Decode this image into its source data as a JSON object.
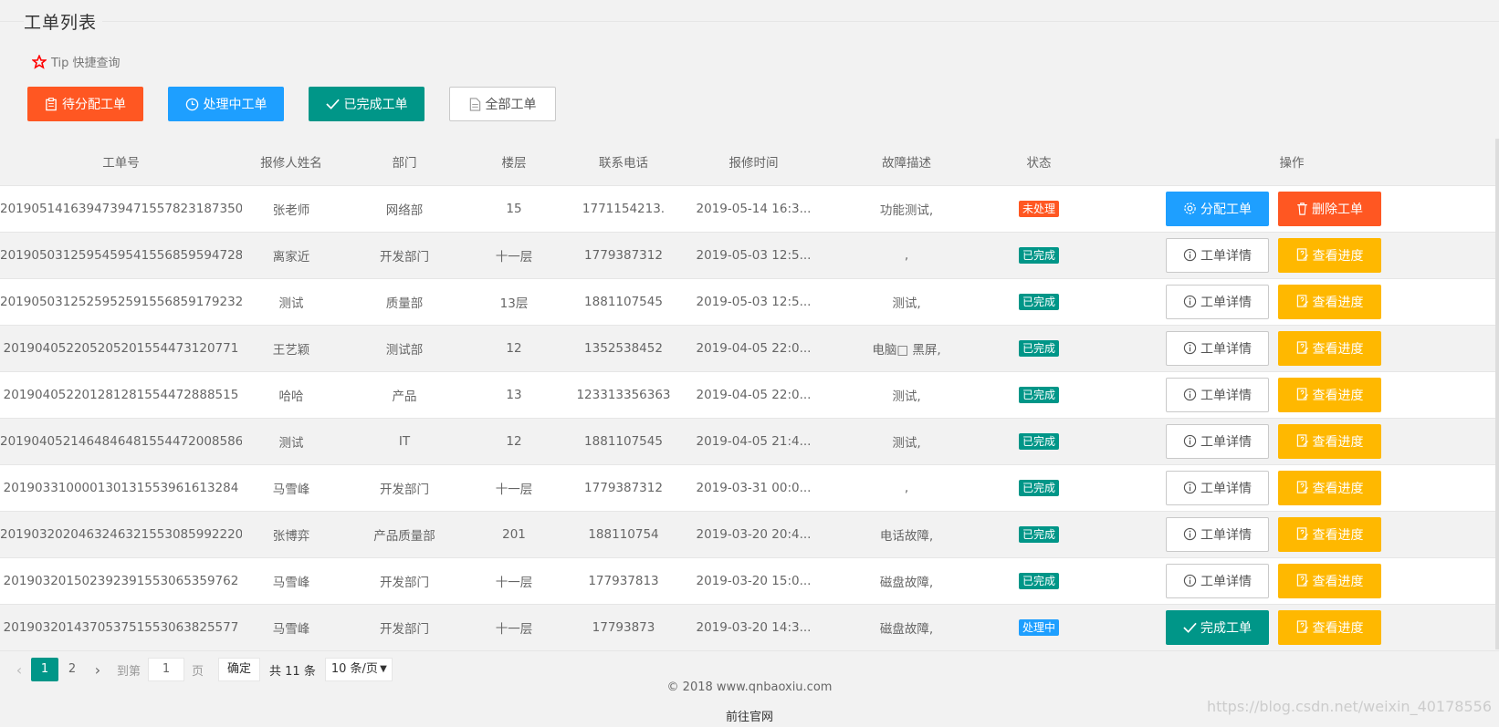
{
  "page": {
    "title": "工单列表"
  },
  "tip": {
    "label": "Tip 快捷查询"
  },
  "filters": [
    {
      "label": "待分配工单",
      "icon": "clipboard-icon",
      "color": "#ff5722"
    },
    {
      "label": "处理中工单",
      "icon": "clock-icon",
      "color": "#1e9fff"
    },
    {
      "label": "已完成工单",
      "icon": "check-icon",
      "color": "#009688"
    },
    {
      "label": "全部工单",
      "icon": "document-icon",
      "color": "#ffffff"
    }
  ],
  "table": {
    "headers": [
      "工单号",
      "报修人姓名",
      "部门",
      "楼层",
      "联系电话",
      "报修时间",
      "故障描述",
      "状态",
      "操作"
    ],
    "rows": [
      {
        "id": "2019051416394739471557823187350",
        "name": "张老师",
        "dept": "网络部",
        "floor": "15",
        "phone": "1771154213.",
        "time": "2019-05-14 16:3...",
        "desc": "功能测试,",
        "status": "未处理",
        "status_type": "pending",
        "unread": true,
        "actions": [
          "分配工单",
          "删除工单"
        ]
      },
      {
        "id": "2019050312595459541556859594728",
        "name": "离家近",
        "dept": "开发部门",
        "floor": "十一层",
        "phone": "177938731​2",
        "time": "2019-05-03 12:5...",
        "desc": ",",
        "status": "已完成",
        "status_type": "done",
        "actions": [
          "工单详情",
          "查看进度"
        ]
      },
      {
        "id": "2019050312525952591556859179232",
        "name": "测试",
        "dept": "质量部",
        "floor": "13层",
        "phone": "1881107545",
        "time": "2019-05-03 12:5...",
        "desc": "测试,",
        "status": "已完成",
        "status_type": "done",
        "actions": [
          "工单详情",
          "查看进度"
        ]
      },
      {
        "id": "2019040522052052015544731207​71",
        "name": "王艺颖",
        "dept": "测试部",
        "floor": "12",
        "phone": "1352538452",
        "time": "2019-04-05 22:0...",
        "desc": "电脑□ 黑屏,",
        "status": "已完成",
        "status_type": "done",
        "actions": [
          "工单详情",
          "查看进度"
        ]
      },
      {
        "id": "2019040522012812815544728885​15",
        "name": "哈哈",
        "dept": "产品",
        "floor": "13",
        "phone": "123313356363",
        "time": "2019-04-05 22:0...",
        "desc": "测试,",
        "status": "已完成",
        "status_type": "done",
        "actions": [
          "工单详情",
          "查看进度"
        ]
      },
      {
        "id": "2019040521464846481554472008586",
        "name": "测试",
        "dept": "IT",
        "floor": "12",
        "phone": "1881107545",
        "time": "2019-04-05 21:4...",
        "desc": "测试,",
        "status": "已完成",
        "status_type": "done",
        "actions": [
          "工单详情",
          "查看进度"
        ]
      },
      {
        "id": "201903310000130131553961613284",
        "name": "马雪峰",
        "dept": "开发部门",
        "floor": "十一层",
        "phone": "177938731​2",
        "time": "2019-03-31 00:0...",
        "desc": ",",
        "status": "已完成",
        "status_type": "done",
        "actions": [
          "工单详情",
          "查看进度"
        ]
      },
      {
        "id": "2019032020463246321553085992220",
        "name": "张博弈",
        "dept": "产品质量部",
        "floor": "201",
        "phone": "188110754",
        "time": "2019-03-20 20:4...",
        "desc": "电话故障,",
        "status": "已完成",
        "status_type": "done",
        "actions": [
          "工单详情",
          "查看进度"
        ]
      },
      {
        "id": "2019032015023923915530653597​62",
        "name": "马雪峰",
        "dept": "开发部门",
        "floor": "十一层",
        "phone": "177937813",
        "time": "2019-03-20 15:0...",
        "desc": "磁盘故障,",
        "status": "已完成",
        "status_type": "done",
        "actions": [
          "工单详情",
          "查看进度"
        ]
      },
      {
        "id": "2019032014370537515530638255​77",
        "name": "马雪峰",
        "dept": "开发部门",
        "floor": "十一层",
        "phone": "17793873",
        "time": "2019-03-20 14:3...",
        "desc": "磁盘故障,",
        "status": "处理中",
        "status_type": "processing",
        "actions": [
          "完成工单",
          "查看进度"
        ]
      }
    ]
  },
  "pager": {
    "pages": [
      "1",
      "2"
    ],
    "current": "1",
    "goto_label": "到第",
    "goto_value": "1",
    "page_unit": "页",
    "confirm": "确定",
    "total": "共 11 条",
    "page_size": "10 条/页"
  },
  "footer": {
    "copyright": "© 2018   www.qnbaoxiu.com",
    "official": "前往官网",
    "watermark": "https://blog.csdn.net/weixin_40178556"
  }
}
